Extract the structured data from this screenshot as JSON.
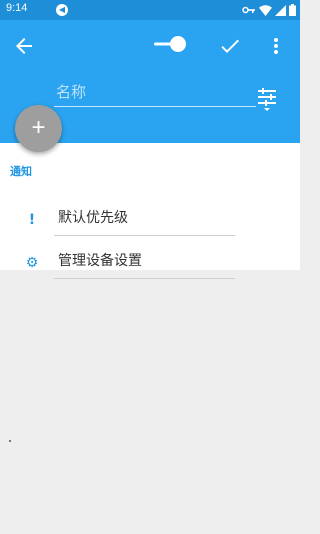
{
  "status_bar": {
    "time": "9:14",
    "icons": [
      "notification-icon",
      "key-icon",
      "wifi-icon",
      "signal-icon",
      "battery-icon"
    ]
  },
  "app_bar": {
    "icons": [
      "arrow-back-icon",
      "toggle-switch",
      "check-icon",
      "more-vert-icon",
      "tune-icon"
    ],
    "toggle_state": "on",
    "name_placeholder": "名称"
  },
  "fab": {
    "label": "+"
  },
  "notifications": {
    "section_title": "通知",
    "items": [
      {
        "icon": "priority-icon",
        "glyph": "!",
        "label": "默认优先级"
      },
      {
        "icon": "settings-icon",
        "glyph": "⚙",
        "label": "管理设备设置"
      }
    ]
  },
  "colors": {
    "status_bar": "#1f8ed8",
    "app_bar": "#2aa3f0",
    "accent": "#1e96e6",
    "fab": "#9e9e9e",
    "background": "#eeeeee"
  }
}
